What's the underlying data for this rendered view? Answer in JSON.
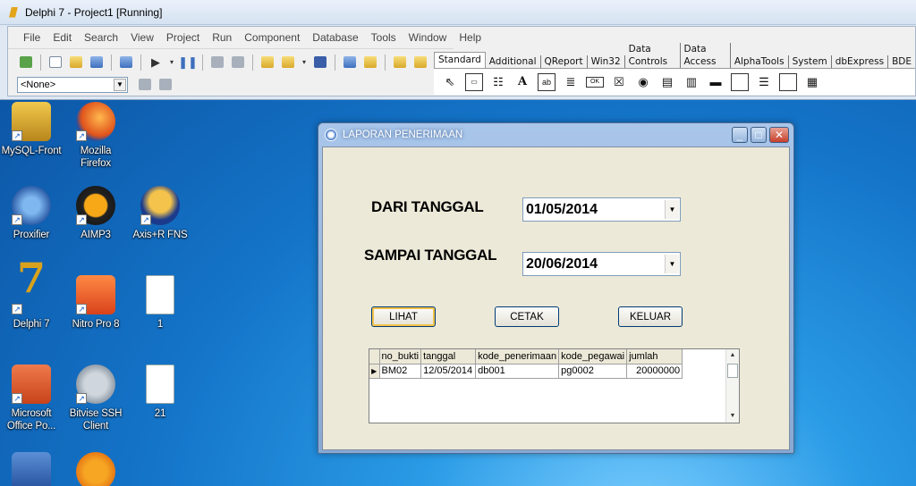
{
  "ide": {
    "title": "Delphi 7 - Project1 [Running]",
    "menu": [
      "File",
      "Edit",
      "Search",
      "View",
      "Project",
      "Run",
      "Component",
      "Database",
      "Tools",
      "Window",
      "Help"
    ],
    "combo_value": "<None>",
    "palette_tabs": [
      "Standard",
      "Additional",
      "QReport",
      "Win32",
      "Data Controls",
      "Data Access",
      "AlphaTools",
      "System",
      "dbExpress",
      "BDE"
    ]
  },
  "desktop": {
    "icons": [
      {
        "label": "MySQL-Front",
        "icon": "mysql-front-icon"
      },
      {
        "label": "Mozilla Firefox",
        "icon": "firefox-icon"
      },
      {
        "label": "Proxifier",
        "icon": "proxifier-icon"
      },
      {
        "label": "AIMP3",
        "icon": "aimp-icon"
      },
      {
        "label": "Axis+R FNS",
        "icon": "axis-icon"
      },
      {
        "label": "Delphi 7",
        "icon": "delphi-icon"
      },
      {
        "label": "Nitro Pro 8",
        "icon": "nitro-icon"
      },
      {
        "label": "1",
        "icon": "text-file-icon"
      },
      {
        "label": "Microsoft Office Po...",
        "icon": "powerpoint-icon"
      },
      {
        "label": "Bitvise SSH Client",
        "icon": "bitvise-icon"
      },
      {
        "label": "21",
        "icon": "text-file-icon"
      }
    ]
  },
  "dialog": {
    "title": "LAPORAN PENERIMAAN",
    "dari_label": "DARI TANGGAL",
    "dari_value": "01/05/2014",
    "sampai_label": "SAMPAI TANGGAL",
    "sampai_value": "20/06/2014",
    "buttons": {
      "lihat": "LIHAT",
      "cetak": "CETAK",
      "keluar": "KELUAR"
    },
    "grid": {
      "columns": [
        "no_bukti",
        "tanggal",
        "kode_penerimaan",
        "kode_pegawai",
        "jumlah"
      ],
      "rows": [
        [
          "BM02",
          "12/05/2014",
          "db001",
          "pg0002",
          "20000000"
        ]
      ]
    }
  }
}
